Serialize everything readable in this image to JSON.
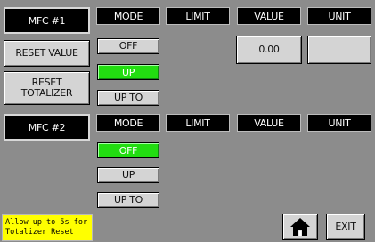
{
  "controller1": {
    "name": "MFC #1",
    "reset_value_label": "RESET VALUE",
    "reset_totalizer_label": "RESET TOTALIZER",
    "mode_options": [
      "OFF",
      "UP",
      "UP TO"
    ],
    "selected_mode": "UP",
    "value_field": "0.00"
  },
  "controller2": {
    "name": "MFC #2",
    "mode_options": [
      "OFF",
      "UP",
      "UP TO"
    ],
    "selected_mode": "OFF"
  },
  "headers": {
    "mode": "MODE",
    "limit": "LIMIT",
    "value": "VALUE",
    "unit": "UNIT"
  },
  "note": "Allow up to 5s for Totalizer Reset",
  "footer": {
    "home_icon": "home-icon",
    "exit_label": "EXIT"
  },
  "colors": {
    "background": "#8c8c8c",
    "active_green": "#22dd11",
    "note_yellow": "#ffff00"
  }
}
